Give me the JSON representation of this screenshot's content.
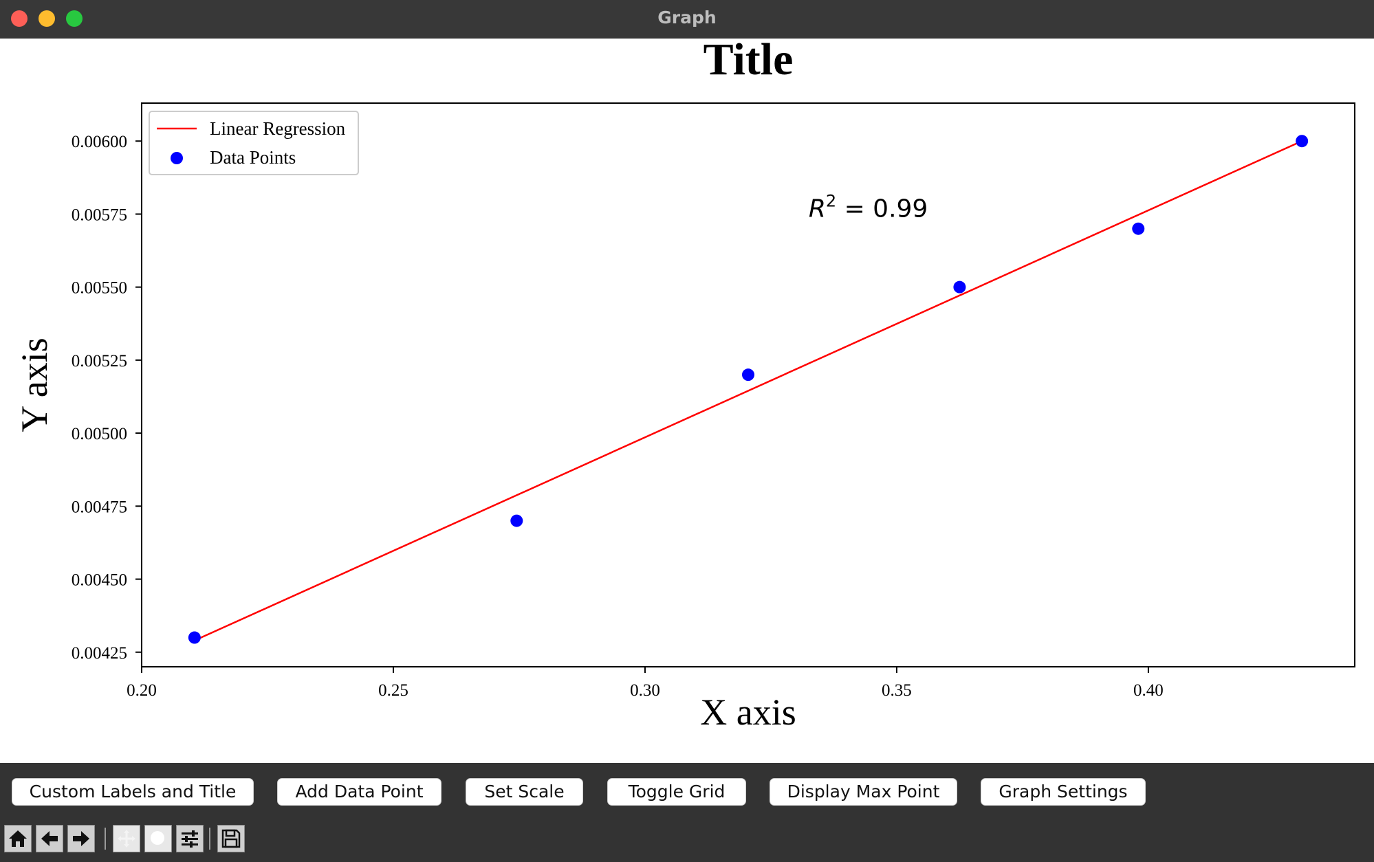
{
  "window": {
    "title": "Graph"
  },
  "colors": {
    "line": "#ff0000",
    "points": "#0000ff",
    "titlebar": "#383838",
    "controls": "#333333"
  },
  "chart_data": {
    "type": "scatter",
    "title": "Title",
    "xlabel": "X axis",
    "ylabel": "Y axis",
    "xlim": [
      0.2,
      0.441
    ],
    "ylim": [
      0.0042,
      0.00613
    ],
    "xticks": [
      0.2,
      0.25,
      0.3,
      0.35,
      0.4
    ],
    "xtick_labels": [
      "0.20",
      "0.25",
      "0.30",
      "0.35",
      "0.40"
    ],
    "yticks": [
      0.00425,
      0.0045,
      0.00475,
      0.005,
      0.00525,
      0.0055,
      0.00575,
      0.006
    ],
    "ytick_labels": [
      "0.00425",
      "0.00450",
      "0.00475",
      "0.00500",
      "0.00525",
      "0.00550",
      "0.00575",
      "0.00600"
    ],
    "grid": false,
    "legend_position": "top-left",
    "series": [
      {
        "name": "Linear Regression",
        "type": "line",
        "color": "#ff0000",
        "x": [
          0.2105,
          0.4305
        ],
        "y": [
          0.00429,
          0.006
        ]
      },
      {
        "name": "Data Points",
        "type": "scatter",
        "color": "#0000ff",
        "x": [
          0.2105,
          0.2745,
          0.3205,
          0.3625,
          0.398,
          0.4305
        ],
        "y": [
          0.0043,
          0.0047,
          0.0052,
          0.0055,
          0.0057,
          0.006
        ]
      }
    ],
    "annotation": {
      "symbol": "R",
      "exponent": "2",
      "value_text": " = 0.99",
      "x": 0.3325,
      "y": 0.00574
    }
  },
  "buttons": {
    "custom_labels": "Custom Labels and Title",
    "add_point": "Add Data Point",
    "set_scale": "Set Scale",
    "toggle_grid": "Toggle Grid",
    "display_max": "Display Max Point",
    "settings": "Graph Settings"
  },
  "toolbar_icons": [
    "home-icon",
    "back-arrow-icon",
    "forward-arrow-icon",
    "pan-icon",
    "zoom-icon",
    "configure-subplots-icon",
    "save-icon"
  ]
}
